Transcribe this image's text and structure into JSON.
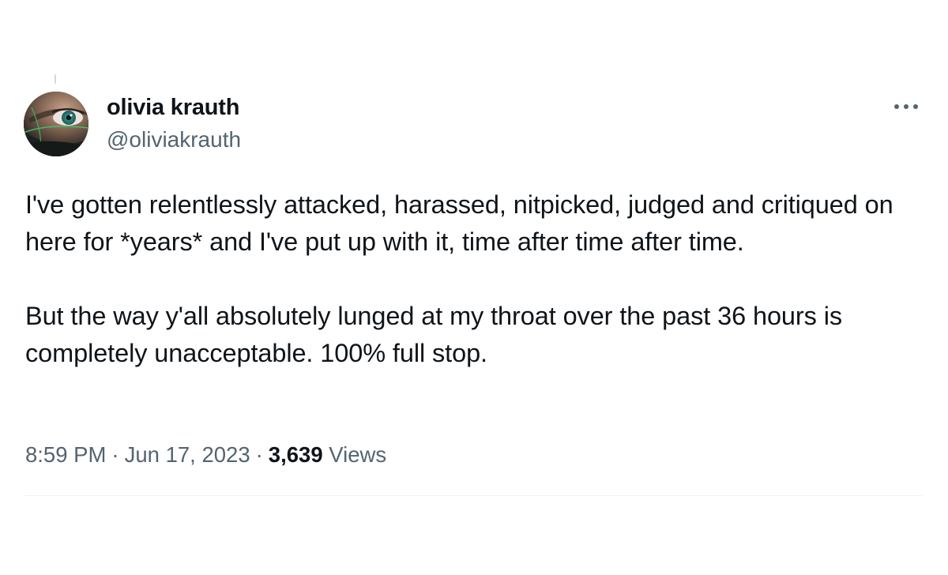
{
  "author": {
    "display_name": "olivia krauth",
    "handle": "@oliviakrauth",
    "avatar_icon": "profile-avatar"
  },
  "tweet": {
    "paragraphs": [
      "I've gotten relentlessly attacked, harassed, nitpicked, judged and critiqued on here for *years* and I've put up with it, time after time after time.",
      "But the way y'all absolutely lunged at my throat over the past 36 hours is completely unacceptable. 100% full stop."
    ]
  },
  "meta": {
    "time": "8:59 PM",
    "separator": "·",
    "date": "Jun 17, 2023",
    "views_count": "3,639",
    "views_label": "Views"
  },
  "icons": {
    "more": "more-horizontal-icon"
  },
  "colors": {
    "text_primary": "#0f1419",
    "text_secondary": "#536471",
    "divider": "#eff3f4"
  }
}
